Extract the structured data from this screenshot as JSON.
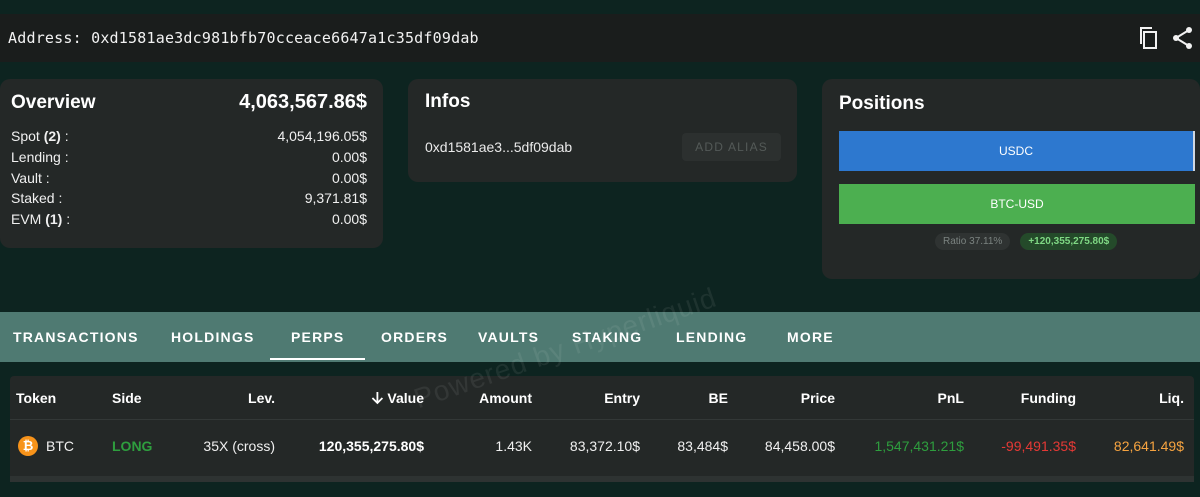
{
  "address": {
    "label": "Address:",
    "value": "0xd1581ae3dc981bfb70cceace6647a1c35df09dab",
    "copy_icon": "copy-icon",
    "share_icon": "share-icon"
  },
  "overview": {
    "title": "Overview",
    "total": "4,063,567.86$",
    "rows": [
      {
        "label": "Spot",
        "count": "(2)",
        "suffix": " :",
        "value": "4,054,196.05$"
      },
      {
        "label": "Lending :",
        "count": "",
        "suffix": "",
        "value": "0.00$"
      },
      {
        "label": "Vault :",
        "count": "",
        "suffix": "",
        "value": "0.00$"
      },
      {
        "label": "Staked :",
        "count": "",
        "suffix": "",
        "value": "9,371.81$"
      },
      {
        "label": "EVM",
        "count": "(1)",
        "suffix": " :",
        "value": "0.00$"
      }
    ]
  },
  "infos": {
    "title": "Infos",
    "short_address": "0xd1581ae3...5df09dab",
    "alias_button": "ADD ALIAS"
  },
  "positions": {
    "title": "Positions",
    "bars": [
      {
        "label": "USDC",
        "color": "#2d78cf"
      },
      {
        "label": "BTC-USD",
        "color": "#4caf50"
      }
    ],
    "ratio_label": "Ratio",
    "ratio_value": "37.11%",
    "pnl": "+120,355,275.80$"
  },
  "tabs": [
    {
      "label": "TRANSACTIONS",
      "active": false
    },
    {
      "label": "HOLDINGS",
      "active": false
    },
    {
      "label": "PERPS",
      "active": true
    },
    {
      "label": "ORDERS",
      "active": false
    },
    {
      "label": "VAULTS",
      "active": false
    },
    {
      "label": "STAKING",
      "active": false
    },
    {
      "label": "LENDING",
      "active": false
    },
    {
      "label": "MORE",
      "active": false
    }
  ],
  "table": {
    "headers": {
      "token": "Token",
      "side": "Side",
      "lev": "Lev.",
      "value": "Value",
      "amount": "Amount",
      "entry": "Entry",
      "be": "BE",
      "price": "Price",
      "pnl": "PnL",
      "funding": "Funding",
      "liq": "Liq."
    },
    "sort_icon": "arrow-down-icon",
    "rows": [
      {
        "token": "BTC",
        "token_icon": "bitcoin-icon",
        "side": "LONG",
        "lev": "35X (cross)",
        "value": "120,355,275.80$",
        "amount": "1.43K",
        "entry": "83,372.10$",
        "be": "83,484$",
        "price": "84,458.00$",
        "pnl": "1,547,431.21$",
        "funding": "-99,491.35$",
        "liq": "82,641.49$"
      }
    ],
    "colors": {
      "long": "#2e9e3e",
      "pnl_positive": "#2e9e3e",
      "funding_negative": "#e53935",
      "liq": "#f5a340"
    }
  },
  "watermark": "Powered by Hyperliquid"
}
